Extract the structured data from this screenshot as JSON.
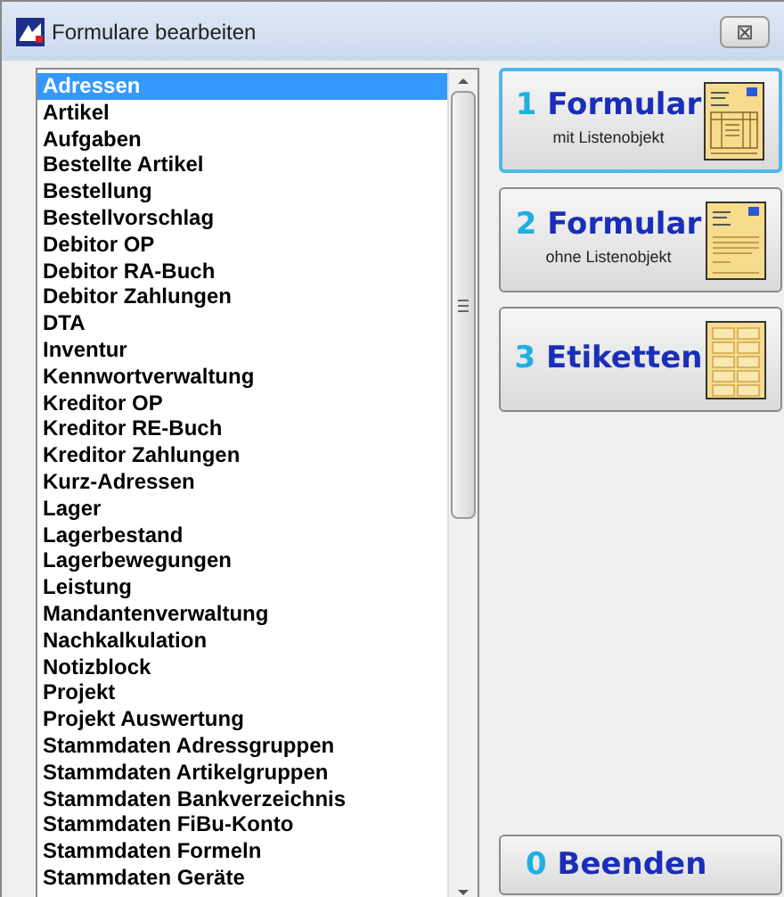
{
  "window": {
    "title": "Formulare bearbeiten",
    "close": "⊠"
  },
  "list": {
    "items": [
      {
        "label": "Adressen",
        "selected": true
      },
      {
        "label": "Artikel",
        "selected": false
      },
      {
        "label": "Aufgaben",
        "selected": false
      },
      {
        "label": "Bestellte Artikel",
        "selected": false
      },
      {
        "label": "Bestellung",
        "selected": false
      },
      {
        "label": "Bestellvorschlag",
        "selected": false
      },
      {
        "label": "Debitor OP",
        "selected": false
      },
      {
        "label": "Debitor RA-Buch",
        "selected": false
      },
      {
        "label": "Debitor Zahlungen",
        "selected": false
      },
      {
        "label": "DTA",
        "selected": false
      },
      {
        "label": "Inventur",
        "selected": false
      },
      {
        "label": "Kennwortverwaltung",
        "selected": false
      },
      {
        "label": "Kreditor OP",
        "selected": false
      },
      {
        "label": "Kreditor RE-Buch",
        "selected": false
      },
      {
        "label": "Kreditor Zahlungen",
        "selected": false
      },
      {
        "label": "Kurz-Adressen",
        "selected": false
      },
      {
        "label": "Lager",
        "selected": false
      },
      {
        "label": "Lagerbestand",
        "selected": false
      },
      {
        "label": "Lagerbewegungen",
        "selected": false
      },
      {
        "label": "Leistung",
        "selected": false
      },
      {
        "label": "Mandantenverwaltung",
        "selected": false
      },
      {
        "label": "Nachkalkulation",
        "selected": false
      },
      {
        "label": "Notizblock",
        "selected": false
      },
      {
        "label": "Projekt",
        "selected": false
      },
      {
        "label": "Projekt Auswertung",
        "selected": false
      },
      {
        "label": "Stammdaten Adressgruppen",
        "selected": false
      },
      {
        "label": "Stammdaten Artikelgruppen",
        "selected": false
      },
      {
        "label": "Stammdaten Bankverzeichnis",
        "selected": false
      },
      {
        "label": "Stammdaten FiBu-Konto",
        "selected": false
      },
      {
        "label": "Stammdaten Formeln",
        "selected": false
      },
      {
        "label": "Stammdaten Geräte",
        "selected": false
      }
    ]
  },
  "buttons": [
    {
      "number": "1",
      "label": "Formular",
      "sublabel": "mit Listenobjekt",
      "kind": "list-form",
      "selected": true
    },
    {
      "number": "2",
      "label": "Formular",
      "sublabel": "ohne Listenobjekt",
      "kind": "letter",
      "selected": false
    },
    {
      "number": "3",
      "label": "Etiketten",
      "kind": "labels",
      "selected": false
    }
  ],
  "exit_button": {
    "number": "0",
    "label": "Beenden"
  }
}
